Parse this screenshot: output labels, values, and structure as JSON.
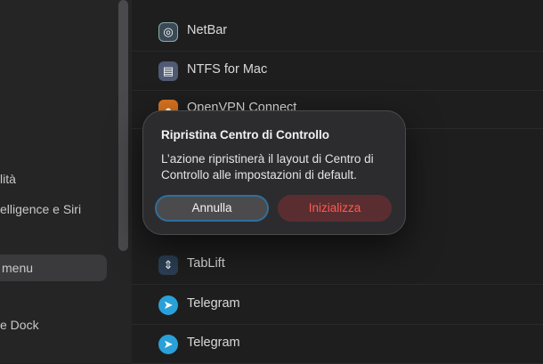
{
  "sidebar": {
    "items": [
      {
        "label": "lità"
      },
      {
        "label": "elligence e Siri"
      },
      {
        "label": "menu"
      },
      {
        "label": "e Dock"
      }
    ]
  },
  "apps": [
    {
      "name": "NetBar",
      "icon": "netbar-icon"
    },
    {
      "name": "NTFS for Mac",
      "icon": "ntfs-icon"
    },
    {
      "name": "OpenVPN Connect",
      "icon": "openvpn-icon"
    },
    {
      "name": "TabLift",
      "icon": "tablift-icon"
    },
    {
      "name": "Telegram",
      "icon": "telegram-icon"
    },
    {
      "name": "Telegram",
      "icon": "telegram-icon"
    }
  ],
  "dialog": {
    "title": "Ripristina Centro di Controllo",
    "message": "L’azione ripristinerà il layout di Centro di Controllo alle impostazioni di default.",
    "cancel_label": "Annulla",
    "reset_label": "Inizializza"
  },
  "colors": {
    "destructive": "#ff5a50",
    "focus_ring": "#2f6f9e"
  }
}
